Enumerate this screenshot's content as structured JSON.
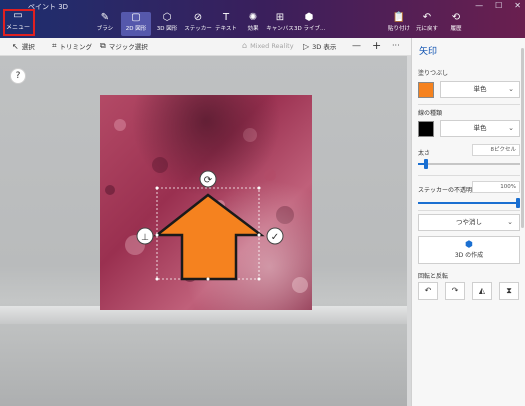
{
  "window": {
    "title": "ペイント 3D",
    "minimize": "—",
    "maximize": "☐",
    "close": "✕"
  },
  "ribbon": {
    "menu": {
      "icon": "folder-icon",
      "label": "メニュー"
    },
    "tools": [
      {
        "key": "brush",
        "icon": "brush-icon",
        "label": "ブラシ"
      },
      {
        "key": "shapes2d",
        "icon": "2d-shapes-icon",
        "label": "2D 図形"
      },
      {
        "key": "shapes3d",
        "icon": "3d-shapes-icon",
        "label": "3D 図形"
      },
      {
        "key": "stickers",
        "icon": "sticker-icon",
        "label": "ステッカー"
      },
      {
        "key": "text",
        "icon": "text-icon",
        "label": "テキスト"
      },
      {
        "key": "effects",
        "icon": "effects-icon",
        "label": "効果"
      },
      {
        "key": "canvas",
        "icon": "canvas-icon",
        "label": "キャンバス"
      },
      {
        "key": "library",
        "icon": "3d-library-icon",
        "label": "3D ライブ..."
      },
      {
        "key": "paste",
        "icon": "paste-icon",
        "label": "貼り付け"
      },
      {
        "key": "undo",
        "icon": "undo-icon",
        "label": "元に戻す"
      },
      {
        "key": "history",
        "icon": "history-icon",
        "label": "履歴"
      }
    ],
    "active_tool": "2D 図形"
  },
  "subbar": {
    "select": "選択",
    "crop": "トリミング",
    "magic_select": "マジック選択",
    "mixed_reality": "Mixed Reality",
    "view3d": "3D 表示",
    "zoom_out": "—",
    "zoom_in": "+",
    "more": "···"
  },
  "workspace": {
    "help": "?"
  },
  "panel": {
    "title": "矢印",
    "fill": {
      "label": "塗りつぶし",
      "color": "#f5821f",
      "type": "単色"
    },
    "line": {
      "label": "線の種類",
      "color": "#000000",
      "type": "単色"
    },
    "size": {
      "label": "太さ",
      "value": "8ピクセル",
      "level": 0.06
    },
    "opacity": {
      "label": "ステッカーの不透明度",
      "value": "100%",
      "level": 1.0
    },
    "finish": {
      "value": "つや消し"
    },
    "make3d": {
      "label": "3D の作成"
    },
    "rotate": {
      "label": "回転と反転",
      "buttons": [
        "↶",
        "↷",
        "◭",
        "⧗"
      ]
    }
  },
  "colors": {
    "accent": "#1a6fd1",
    "arrow": "#f5821f",
    "menu_highlight": "#e02020"
  }
}
